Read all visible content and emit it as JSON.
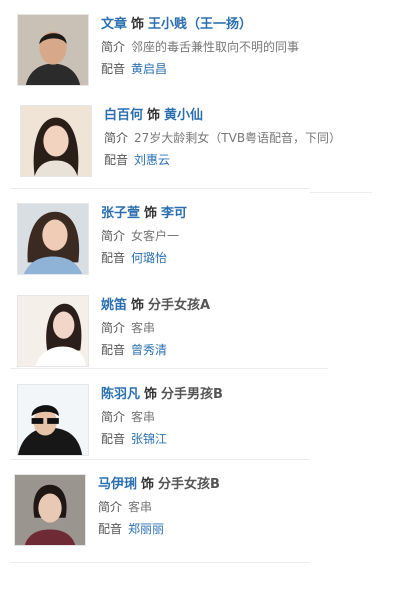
{
  "cast": [
    {
      "actor": "文章",
      "connector": "饰",
      "role": "王小贱（王一扬）",
      "intro_label": "简介",
      "intro": "邻座的毒舌兼性取向不明的同事",
      "voice_label": "配音",
      "voice": "黄启昌",
      "photo": {
        "bg": "#c9c1b6",
        "skin": "#d7a98a",
        "hair": "#1f1a17",
        "cloth": "#2b2b2b"
      }
    },
    {
      "actor": "白百何",
      "connector": "饰",
      "role": "黄小仙",
      "intro_label": "简介",
      "intro": "27岁大龄剩女（TVB粤语配音，下同）",
      "voice_label": "配音",
      "voice": "刘惠云",
      "photo": {
        "bg": "#efe4d6",
        "skin": "#f1d3bf",
        "hair": "#2a1e19",
        "cloth": "#e9e2d8"
      }
    },
    {
      "actor": "张子萱",
      "connector": "饰",
      "role": "李可",
      "intro_label": "简介",
      "intro": "女客户一",
      "voice_label": "配音",
      "voice": "何璐怡",
      "photo": {
        "bg": "#d9dee3",
        "skin": "#f0ccb6",
        "hair": "#3b2a22",
        "cloth": "#8fb3d6"
      }
    },
    {
      "actor": "姚笛",
      "connector": "饰",
      "role": "分手女孩A",
      "intro_label": "简介",
      "intro": "客串",
      "voice_label": "配音",
      "voice": "曾秀清",
      "photo": {
        "bg": "#f4efe9",
        "skin": "#f2d6c7",
        "hair": "#2b1f1b",
        "cloth": "#ffffff"
      }
    },
    {
      "actor": "陈羽凡",
      "connector": "饰",
      "role": "分手男孩B",
      "intro_label": "简介",
      "intro": "客串",
      "voice_label": "配音",
      "voice": "张锦江",
      "photo": {
        "bg": "#f3f6f9",
        "skin": "#e6c2a6",
        "hair": "#111111",
        "cloth": "#171717"
      }
    },
    {
      "actor": "马伊琍",
      "connector": "饰",
      "role": "分手女孩B",
      "intro_label": "简介",
      "intro": "客串",
      "voice_label": "配音",
      "voice": "郑丽丽",
      "photo": {
        "bg": "#9b9590",
        "skin": "#e7c9b5",
        "hair": "#1e1714",
        "cloth": "#6e2b35"
      }
    }
  ]
}
